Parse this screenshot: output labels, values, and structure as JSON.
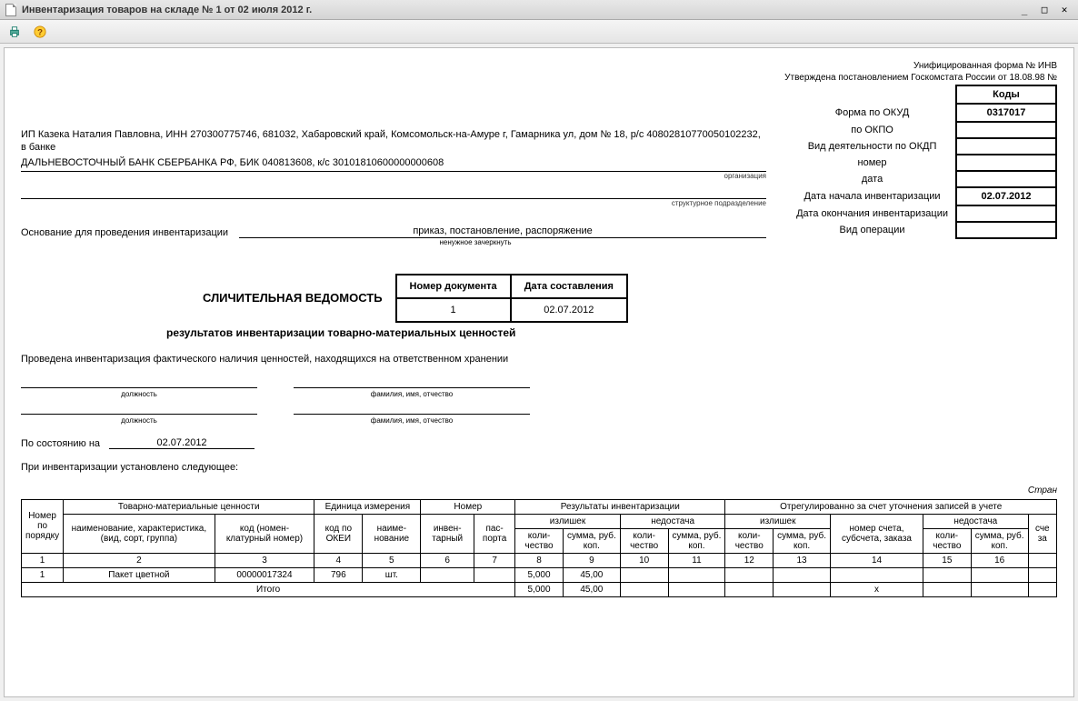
{
  "window": {
    "title": "Инвентаризация товаров на складе № 1 от 02 июля 2012 г."
  },
  "topright": {
    "line1": "Унифицированная форма № ИНВ",
    "line2": "Утверждена постановлением Госкомстата России от 18.08.98 №"
  },
  "codes": {
    "header": "Коды",
    "rows": [
      {
        "label": "Форма по ОКУД",
        "value": "0317017"
      },
      {
        "label": "по ОКПО",
        "value": ""
      },
      {
        "label": "Вид деятельности по ОКДП",
        "value": ""
      },
      {
        "label": "номер",
        "value": ""
      },
      {
        "label": "дата",
        "value": ""
      },
      {
        "label": "Дата начала инвентаризации",
        "value": "02.07.2012"
      },
      {
        "label": "Дата окончания инвентаризации",
        "value": ""
      },
      {
        "label": "Вид операции",
        "value": ""
      }
    ]
  },
  "org": {
    "text1": "ИП Казека Наталия Павловна, ИНН 270300775746, 681032, Хабаровский край, Комсомольск-на-Амуре г, Гамарника ул, дом № 18, р/с 40802810770050102232, в банке",
    "text2": "ДАЛЬНЕВОСТОЧНЫЙ БАНК СБЕРБАНКА РФ, БИК 040813608, к/с 30101810600000000608",
    "sub_org": "организация",
    "sub_struct": "структурное подразделение"
  },
  "basis": {
    "label": "Основание для проведения инвентаризации",
    "value": "приказ, постановление, распоряжение",
    "hint": "ненужное зачеркнуть"
  },
  "docnum": {
    "h1": "Номер документа",
    "h2": "Дата составления",
    "v1": "1",
    "v2": "02.07.2012"
  },
  "title": {
    "main": "СЛИЧИТЕЛЬНАЯ ВЕДОМОСТЬ",
    "sub": "результатов инвентаризации товарно-материальных ценностей"
  },
  "intro": "Проведена инвентаризация фактического наличия ценностей, находящихся на ответственном хранении",
  "sign_sub": {
    "pos": "должность",
    "fio": "фамилия, имя, отчество"
  },
  "state": {
    "label": "По состоянию на",
    "value": "02.07.2012"
  },
  "inv_note": "При инвентаризации установлено следующее:",
  "page_label": "Стран",
  "table": {
    "headers": {
      "num": "Номер по порядку",
      "tmc": "Товарно-материальные ценности",
      "unit": "Единица измерения",
      "number": "Номер",
      "results": "Результаты инвентаризации",
      "adjusted": "Отрегулированно за счет уточнения записей в учете",
      "name": "наименование, характеристика, (вид, сорт, группа)",
      "code": "код (номен-клатурный номер)",
      "okei": "код по ОКЕИ",
      "unit_name": "наиме-нование",
      "inv": "инвен-тарный",
      "pass": "пас-порта",
      "surplus": "излишек",
      "shortage": "недостача",
      "qty": "коли-чество",
      "sum": "сумма, руб. коп.",
      "acct": "номер счета, субсчета, заказа",
      "sch": "сче за"
    },
    "colnums": [
      "1",
      "2",
      "3",
      "4",
      "5",
      "6",
      "7",
      "8",
      "9",
      "10",
      "11",
      "12",
      "13",
      "14",
      "15",
      "16"
    ],
    "rows": [
      {
        "n": "1",
        "name": "Пакет цветной",
        "code": "00000017324",
        "okei": "796",
        "unit": "шт.",
        "inv": "",
        "pass": "",
        "s_qty": "5,000",
        "s_sum": "45,00",
        "sh_qty": "",
        "sh_sum": "",
        "a_s_qty": "",
        "a_s_sum": "",
        "acct": "",
        "a_sh_qty": "",
        "a_sh_sum": ""
      }
    ],
    "total": {
      "label": "Итого",
      "s_qty": "5,000",
      "s_sum": "45,00",
      "mark": "х"
    }
  }
}
